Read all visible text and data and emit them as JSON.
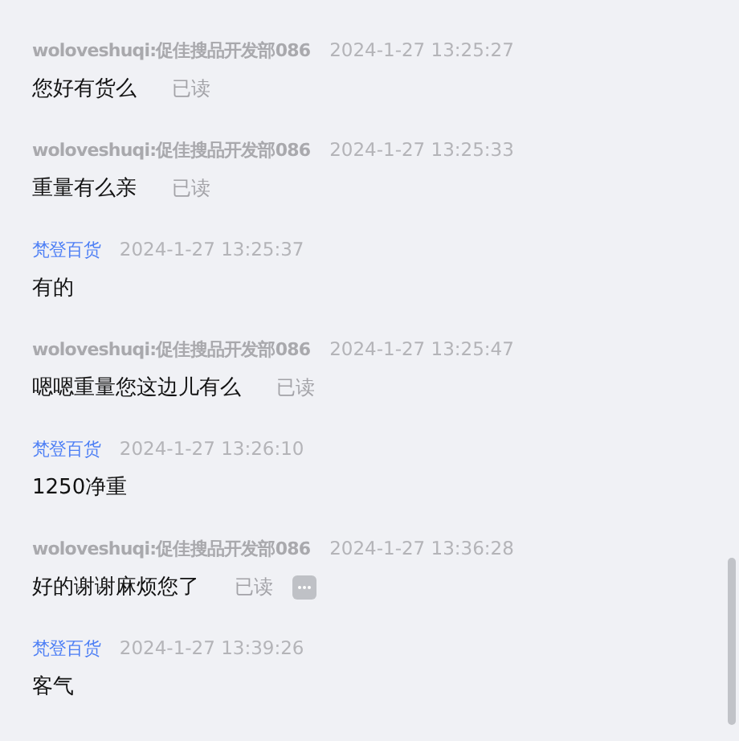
{
  "messages": [
    {
      "kind": "customer",
      "sender": "woloveshuqi:促佳搜品开发部086",
      "time": "2024-1-27 13:25:27",
      "text": "您好有货么",
      "status": "已读"
    },
    {
      "kind": "customer",
      "sender": "woloveshuqi:促佳搜品开发部086",
      "time": "2024-1-27 13:25:33",
      "text": "重量有么亲",
      "status": "已读"
    },
    {
      "kind": "shop",
      "sender": "梵登百货",
      "time": "2024-1-27 13:25:37",
      "text": "有的"
    },
    {
      "kind": "customer",
      "sender": "woloveshuqi:促佳搜品开发部086",
      "time": "2024-1-27 13:25:47",
      "text": "嗯嗯重量您这边儿有么",
      "status": "已读"
    },
    {
      "kind": "shop",
      "sender": "梵登百货",
      "time": "2024-1-27 13:26:10",
      "text": "1250净重"
    },
    {
      "kind": "customer",
      "sender": "woloveshuqi:促佳搜品开发部086",
      "time": "2024-1-27 13:36:28",
      "text": "好的谢谢麻烦您了",
      "status": "已读",
      "more": true
    },
    {
      "kind": "shop",
      "sender": "梵登百货",
      "time": "2024-1-27 13:39:26",
      "text": "客气"
    }
  ]
}
